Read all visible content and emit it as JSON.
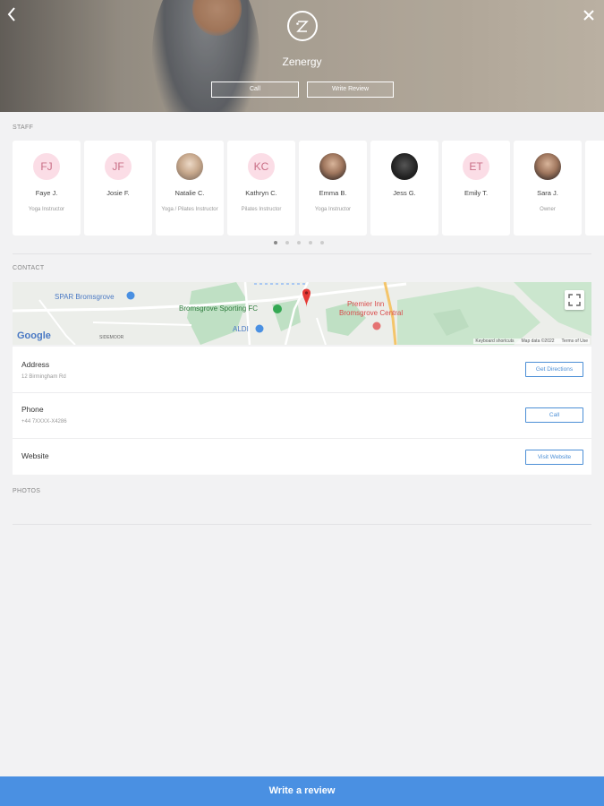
{
  "hero": {
    "brand_name": "Zenergy",
    "call_label": "Call",
    "write_review_label": "Write Review"
  },
  "sections": {
    "staff": "STAFF",
    "contact": "CONTACT",
    "photos": "PHOTOS"
  },
  "staff": [
    {
      "initials": "FJ",
      "name": "Faye J.",
      "role": "Yoga Instructor",
      "photo": false
    },
    {
      "initials": "JF",
      "name": "Josie F.",
      "role": "",
      "photo": false
    },
    {
      "initials": "",
      "name": "Natalie C.",
      "role": "Yoga / Pilates Instructor",
      "photo": true
    },
    {
      "initials": "KC",
      "name": "Kathryn C.",
      "role": "Pilates Instructor",
      "photo": false
    },
    {
      "initials": "",
      "name": "Emma B.",
      "role": "Yoga Instructor",
      "photo": true
    },
    {
      "initials": "",
      "name": "Jess G.",
      "role": "",
      "photo": true
    },
    {
      "initials": "ET",
      "name": "Emily T.",
      "role": "",
      "photo": false
    },
    {
      "initials": "",
      "name": "Sara J.",
      "role": "Owner",
      "photo": true
    }
  ],
  "carousel": {
    "pages": 5,
    "active_page": 1
  },
  "map": {
    "labels": {
      "spar": "SPAR Bromsgrove",
      "sporting": "Bromsgrove Sporting FC",
      "aldi": "ALDI",
      "premier_1": "Premier Inn",
      "premier_2": "Bromsgrove Central",
      "google": "Google",
      "sidemoor": "SIDEMOOR"
    },
    "attribution": {
      "shortcuts": "Keyboard shortcuts",
      "map_data": "Map data ©2022",
      "terms": "Terms of Use"
    }
  },
  "contact": {
    "address_label": "Address",
    "address_value": "12 Birmingham Rd",
    "directions_button": "Get Directions",
    "phone_label": "Phone",
    "phone_value": "+44 7XXXX-X4286",
    "call_button": "Call",
    "website_label": "Website",
    "website_button": "Visit Website"
  },
  "bottom_bar": {
    "label": "Write a review"
  },
  "colors": {
    "accent": "#4a90e2",
    "avatar_bg": "#fbdde6",
    "avatar_text": "#c96e86",
    "map_pin": "#e53935"
  }
}
